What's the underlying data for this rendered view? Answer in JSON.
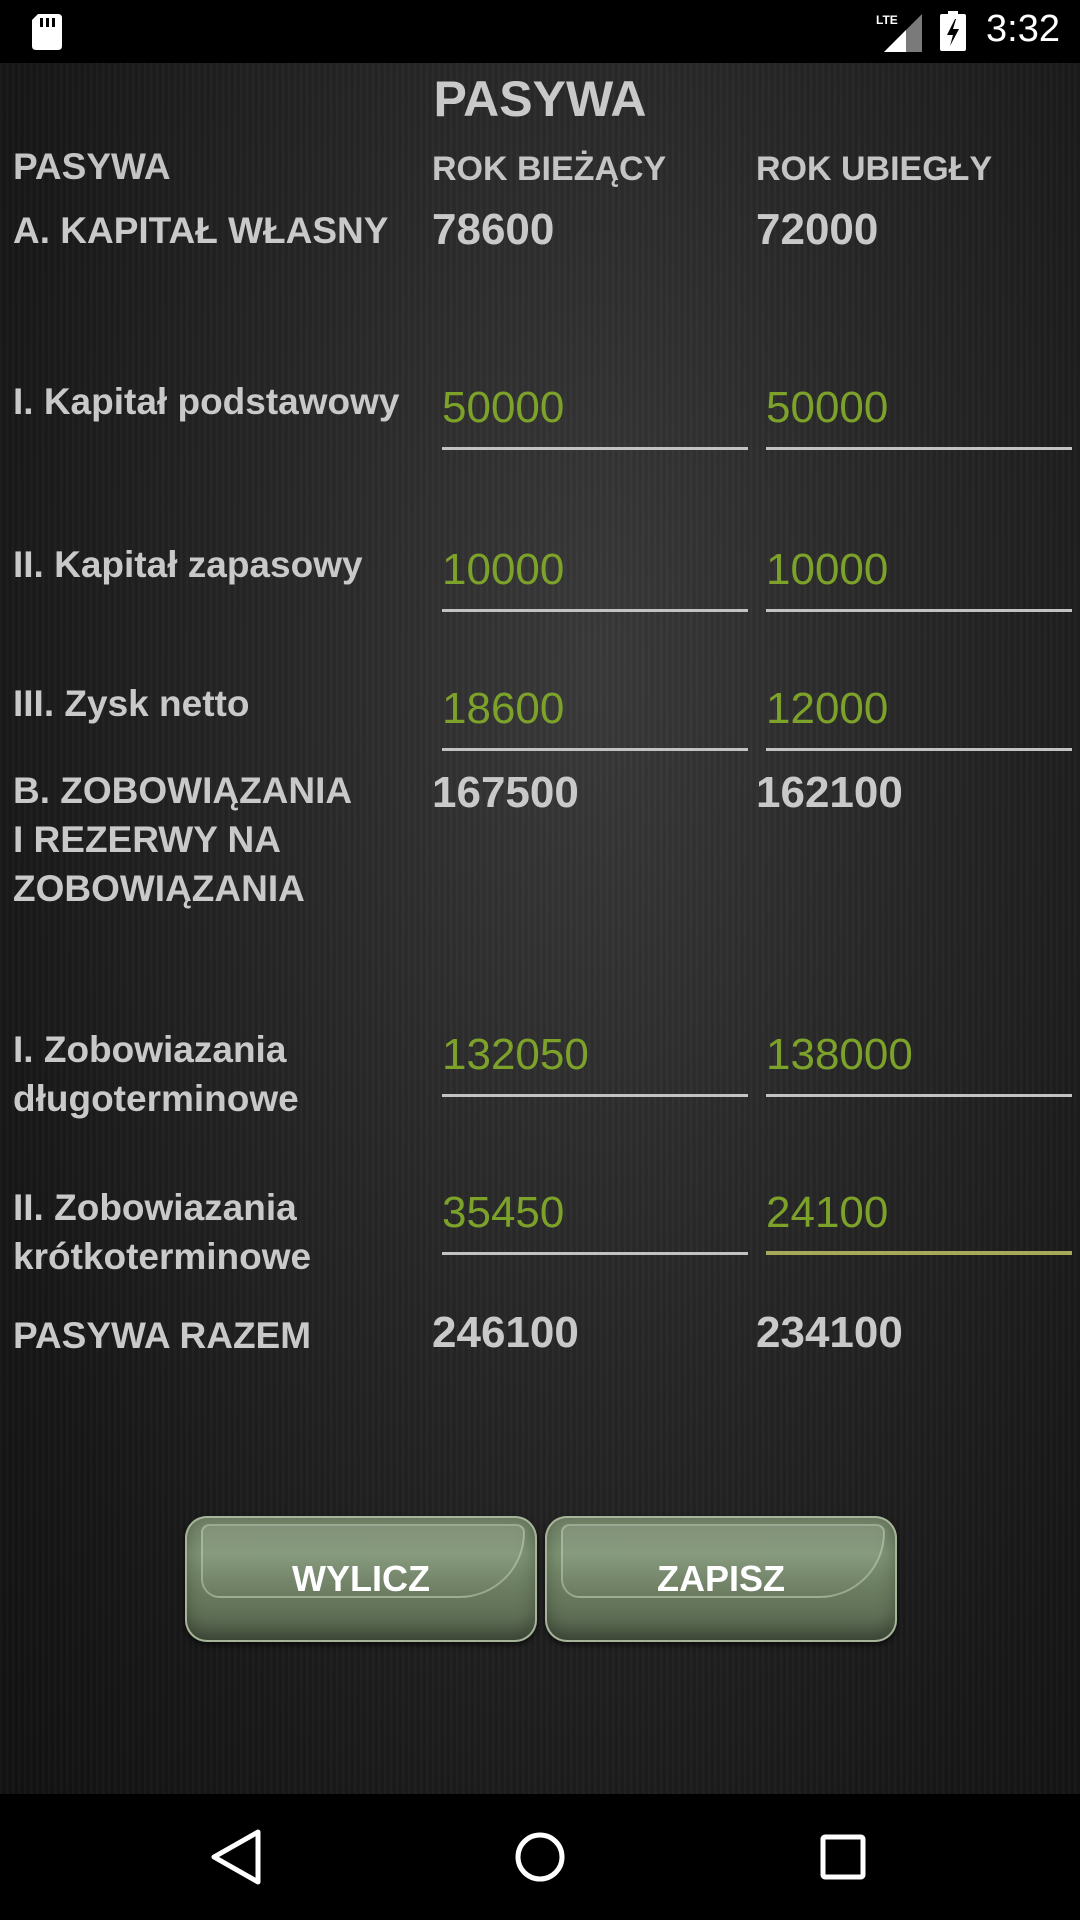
{
  "status_bar": {
    "time": "3:32",
    "network": "LTE",
    "icons": [
      "sd-card-icon",
      "signal-icon",
      "battery-charging-icon"
    ]
  },
  "title": "PASYWA",
  "headers": {
    "label": "PASYWA",
    "current_year": "ROK BIEŻĄCY",
    "previous_year": "ROK UBIEGŁY"
  },
  "sections": {
    "a": {
      "label": "A. KAPITAŁ WŁASNY",
      "current": "78600",
      "previous": "72000"
    },
    "b": {
      "label_line1": "B. ZOBOWIĄZANIA",
      "label_line2": "I REZERWY NA",
      "label_line3": "ZOBOWIĄZANIA",
      "current": "167500",
      "previous": "162100"
    }
  },
  "rows": {
    "kapital_podstawowy": {
      "label": "I. Kapitał podstawowy",
      "current": "50000",
      "previous": "50000"
    },
    "kapital_zapasowy": {
      "label": "II. Kapitał zapasowy",
      "current": "10000",
      "previous": "10000"
    },
    "zysk_netto": {
      "label": "III. Zysk netto",
      "current": "18600",
      "previous": "12000"
    },
    "zob_dlugo": {
      "label_line1": "I. Zobowiazania",
      "label_line2": "długoterminowe",
      "current": "132050",
      "previous": "138000"
    },
    "zob_krotko": {
      "label_line1": "II. Zobowiazania",
      "label_line2": "krótkoterminowe",
      "current": "35450",
      "previous": "24100"
    }
  },
  "total": {
    "label": "PASYWA RAZEM",
    "current": "246100",
    "previous": "234100"
  },
  "buttons": {
    "calculate": "WYLICZ",
    "save": "ZAPISZ"
  },
  "colors": {
    "input_text": "#7da22a",
    "focused_underline": "#a7a85a",
    "button": "#6d7e63"
  },
  "navigation": [
    "back-icon",
    "home-icon",
    "recents-icon"
  ]
}
